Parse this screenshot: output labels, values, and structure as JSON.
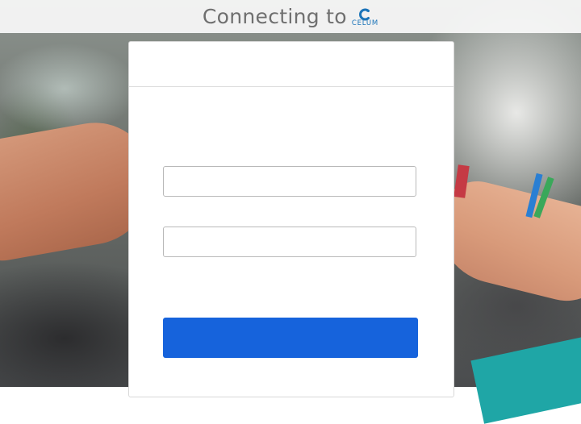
{
  "header": {
    "title": "Connecting to",
    "logo_text": "CELUM",
    "logo_icon": "celum-logo-icon"
  },
  "login": {
    "username_value": "",
    "password_value": "",
    "submit_label": ""
  },
  "colors": {
    "accent": "#1663dc",
    "brand": "#1a73b8",
    "header_text": "#6f6f6f"
  }
}
